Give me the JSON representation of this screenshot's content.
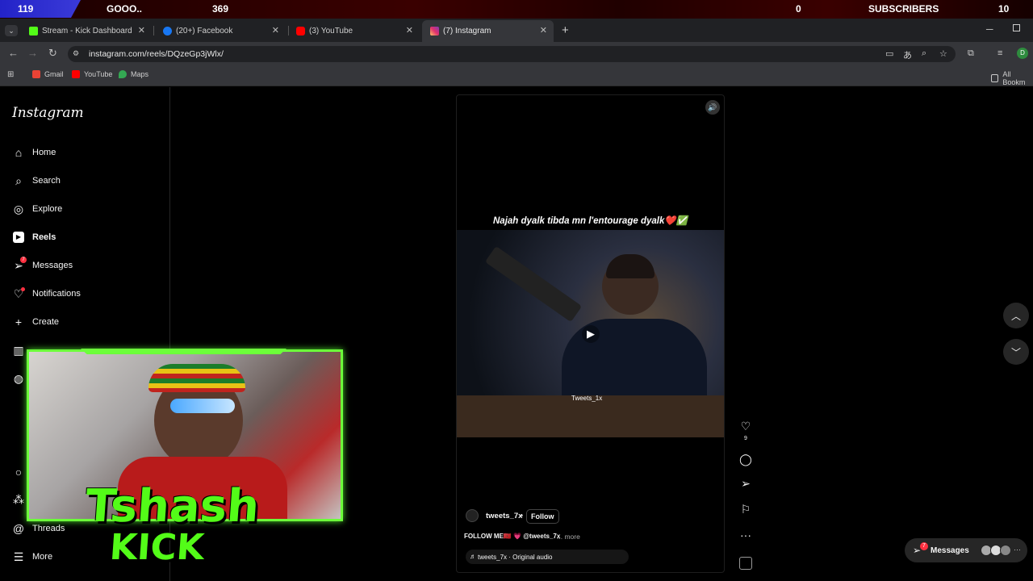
{
  "overlay": {
    "left_count": "119",
    "goal_label": "GOOO..",
    "goal_count": "369",
    "mid_count": "0",
    "subs_label": "SUBSCRIBERS",
    "subs_count": "10"
  },
  "browser": {
    "tabs": [
      {
        "title": "Stream - Kick Dashboard",
        "icon": "kick-icon",
        "color": "#53fc18"
      },
      {
        "title": "(20+) Facebook",
        "icon": "facebook-icon",
        "color": "#1877f2"
      },
      {
        "title": "(3) YouTube",
        "icon": "youtube-icon",
        "color": "#ff0000"
      },
      {
        "title": "(7) Instagram",
        "icon": "instagram-icon",
        "color": "#e1306c"
      }
    ],
    "url": "instagram.com/reels/DQzeGp3jWlx/",
    "bookmarks": [
      "Gmail",
      "YouTube",
      "Maps"
    ],
    "all_bookmarks": "All Bookm"
  },
  "instagram": {
    "logo": "Instagram",
    "nav": [
      "Home",
      "Search",
      "Explore",
      "Reels",
      "Messages",
      "Notifications",
      "Create",
      "Threads",
      "More"
    ],
    "messages_badge": "7",
    "reel": {
      "caption": "Najah dyalk tibda mn l'entourage dyalk❤️✅",
      "watermark": "Tweets_1x",
      "username": "tweets_7x",
      "follow": "Follow",
      "description": "FOLLOW ME🇲🇦 💗 @tweets_7x",
      "more": "... more",
      "audio": "tweets_7x · Original audio",
      "likes": "9"
    },
    "messages_button": "Messages",
    "messages_button_badge": "7"
  },
  "stream": {
    "kick_line1": "Tshash",
    "kick_line2": "KICK"
  },
  "colors": {
    "kick_green": "#53fc18",
    "ig_red": "#ff3040",
    "tab_bg": "#202124"
  }
}
